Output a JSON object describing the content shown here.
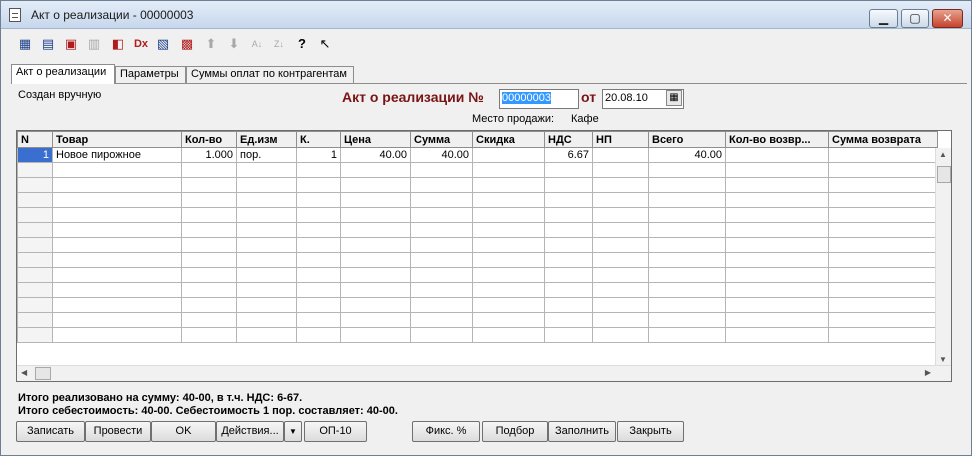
{
  "window": {
    "title": "Акт о реализации - 00000003",
    "controls": [
      "minimize",
      "maximize",
      "close"
    ]
  },
  "toolbar": {
    "icons": [
      "new-row-icon",
      "copy-row-icon",
      "delete-row-icon",
      "mark-row-icon",
      "delete-marked-icon",
      "delete-all-icon",
      "edit-icon",
      "select-icon",
      "move-up-icon",
      "move-down-icon",
      "sort-asc-icon",
      "sort-desc-icon",
      "help-icon",
      "context-help-icon"
    ]
  },
  "tabs": [
    "Акт о реализации",
    "Параметры",
    "Суммы оплат по контрагентам"
  ],
  "header": {
    "created_note": "Создан вручную",
    "doc_title": "Акт о реализации №",
    "doc_number": "00000003",
    "from_label": "от",
    "date": "20.08.10",
    "sale_place_label": "Место продажи:",
    "sale_place_value": "Кафе"
  },
  "table": {
    "columns": [
      "N",
      "Товар",
      "Кол-во",
      "Ед.изм",
      "К.",
      "Цена",
      "Сумма",
      "Скидка",
      "НДС",
      "НП",
      "Всего",
      "Кол-во возвр...",
      "Сумма возврата"
    ],
    "rows": [
      [
        "1",
        "Новое пирожное",
        "1.000",
        "пор.",
        "1",
        "40.00",
        "40.00",
        "",
        "6.67",
        "",
        "40.00",
        "",
        ""
      ]
    ],
    "active_row": 0
  },
  "totals": {
    "line1": "Итого реализовано на сумму: 40-00, в т.ч. НДС: 6-67.",
    "line2": "Итого себестоимость: 40-00.   Себестоимость 1 пор. составляет: 40-00."
  },
  "buttons": {
    "save": "Записать",
    "post": "Провести",
    "ok": "OK",
    "actions": "Действия...",
    "op10": "ОП-10",
    "fix_percent": "Фикс. %",
    "pick": "Подбор",
    "fill": "Заполнить",
    "close": "Закрыть"
  }
}
